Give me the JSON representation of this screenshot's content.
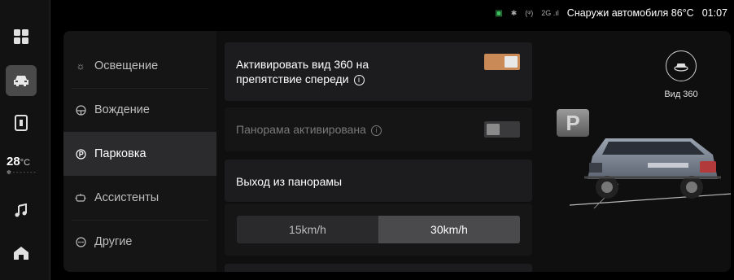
{
  "status_bar": {
    "icons": [
      "android-auto-icon",
      "bluetooth-icon",
      "hotspot-icon",
      "signal-2g-icon"
    ],
    "signal_label": "2G",
    "outside_temp_text": "Снаружи автомобиля 86°C",
    "time": "01:07"
  },
  "dock": {
    "items": [
      "apps-icon",
      "car-icon",
      "phone-icon",
      "music-icon",
      "home-icon"
    ],
    "active": "car-icon",
    "temperature": "28",
    "temperature_unit": "°C"
  },
  "menu": {
    "items": [
      {
        "label": "Освещение",
        "icon": "sun-icon"
      },
      {
        "label": "Вождение",
        "icon": "steering-wheel-icon"
      },
      {
        "label": "Парковка",
        "icon": "parking-icon"
      },
      {
        "label": "Ассистенты",
        "icon": "assist-icon"
      },
      {
        "label": "Другие",
        "icon": "more-icon"
      }
    ],
    "active_index": 2
  },
  "settings": {
    "activate_360_front": {
      "label": "Активировать вид 360 на препятствие спереди",
      "state": "on"
    },
    "panorama_activated": {
      "label": "Панорама активирована",
      "state": "off",
      "disabled": true
    },
    "panorama_exit": {
      "label": "Выход из панорамы",
      "options": [
        "15km/h",
        "30km/h"
      ],
      "selected": "30km/h"
    }
  },
  "visual": {
    "view360_label": "Вид 360",
    "parking_sign": "P"
  },
  "colors": {
    "accent": "#c98a58",
    "background": "#000000",
    "panel": "#0f0f10",
    "card": "#1c1c1e",
    "active_menu": "#2b2b2d"
  }
}
